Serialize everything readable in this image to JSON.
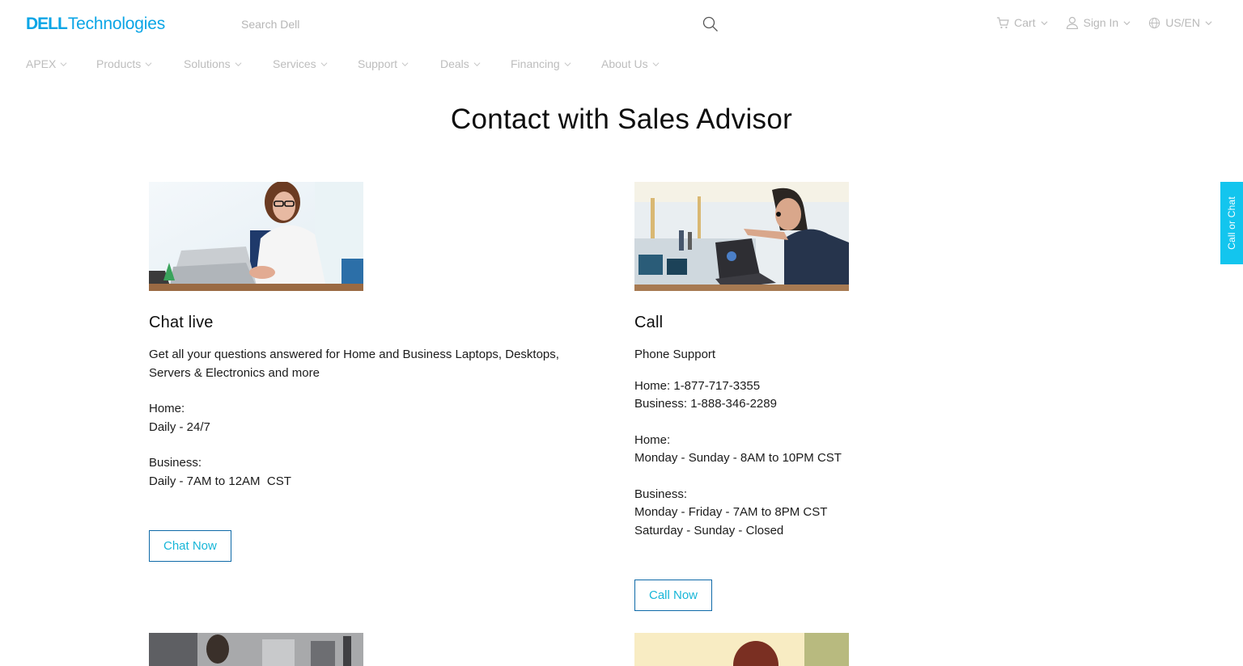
{
  "header": {
    "logo": {
      "brand": "DELL",
      "suffix": "Technologies"
    },
    "search_placeholder": "Search Dell",
    "utils": [
      {
        "label": "Cart",
        "icon": "cart-icon"
      },
      {
        "label": "Sign In",
        "icon": "user-icon"
      },
      {
        "label": "US/EN",
        "icon": "globe-icon"
      }
    ]
  },
  "nav": {
    "items": [
      {
        "label": "APEX"
      },
      {
        "label": "Products"
      },
      {
        "label": "Solutions"
      },
      {
        "label": "Services"
      },
      {
        "label": "Support"
      },
      {
        "label": "Deals"
      },
      {
        "label": "Financing"
      },
      {
        "label": "About Us"
      }
    ]
  },
  "main": {
    "title": "Contact with Sales Advisor",
    "chat": {
      "heading": "Chat live",
      "description": "Get all your questions answered for Home and Business Laptops, Desktops, Servers & Electronics and more",
      "home_label": "Home:",
      "home_hours": "Daily - 24/7",
      "business_label": "Business:",
      "business_hours": "Daily - 7AM to 12AM  CST",
      "button": "Chat Now"
    },
    "call": {
      "heading": "Call",
      "subheading": "Phone Support",
      "home_phone": "Home: 1-877-717-3355",
      "business_phone": "Business: 1-888-346-2289",
      "home_label": "Home:",
      "home_hours": "Monday - Sunday - 8AM to 10PM CST",
      "business_label": "Business:",
      "business_hours_weekday": "Monday - Friday - 7AM to 8PM CST",
      "business_hours_weekend": "Saturday - Sunday - Closed",
      "button": "Call Now"
    }
  },
  "side_tab": {
    "label": "Call or Chat"
  },
  "colors": {
    "brand": "#0aa5e6",
    "accent": "#13c5ee",
    "button_text": "#17b6d8"
  }
}
